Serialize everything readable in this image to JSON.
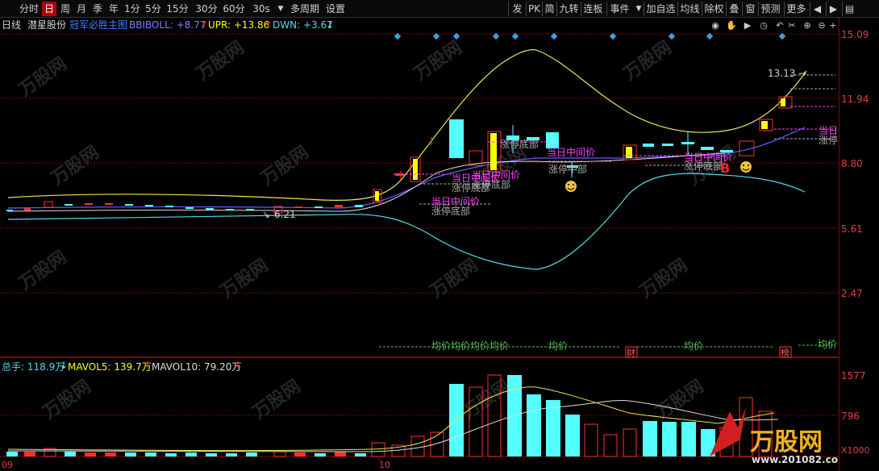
{
  "toolbar": {
    "periods": [
      "分时",
      "日",
      "周",
      "月",
      "季",
      "年",
      "1分",
      "5分",
      "15分",
      "30分",
      "60分",
      "30s"
    ],
    "active_period": "日",
    "multi_period": "多周期",
    "settings": "设置",
    "right_items": [
      "发",
      "PK",
      "简",
      "九转",
      "连板",
      "事件",
      "加自选",
      "均线",
      "除权",
      "叠",
      "窗",
      "预测",
      "更多"
    ],
    "event_dropdown": "▼"
  },
  "info": {
    "period": "日线",
    "stock_name": "潜星股份",
    "indicator_name": "冠军必胜主图",
    "bbiboll": "BBIBOLL: +8.77",
    "upr": "UPR: +13.86",
    "dwn": "DWN: +3.67"
  },
  "price_axis": [
    "15.09",
    "11.94",
    "8.80",
    "5.61",
    "2.47"
  ],
  "volume_axis": [
    "1577",
    "796",
    "X1000"
  ],
  "volume_info": {
    "total": "总手: 118.9万",
    "mavol5": "MAVOL5: 139.7万",
    "mavol10": "MAVOL10: 79.20万"
  },
  "annotations": {
    "high_label": "13.13",
    "low_label": "6.21",
    "mid_price": "当日中间价",
    "limit_up_bottom": "涨停底部",
    "limit_up_bottom_short": "涨停",
    "avg_price": "均价",
    "avg_price_repeat": "均价均价均价均价",
    "fin_marker": "财",
    "rank_marker": "榜",
    "zhangtingdibu_mid": "涨停中部",
    "buy_signal": "B",
    "mid_price_right": "当日"
  },
  "x_axis": [
    "09",
    "10"
  ],
  "watermark": "万股网",
  "watermark_url": "www.201082.com",
  "colors": {
    "up": "#ff3030",
    "down": "#54ffff",
    "yellow": "#ffff00",
    "magenta": "#ff40ff",
    "cyan": "#54d8e8",
    "grid": "#8b0000"
  }
}
